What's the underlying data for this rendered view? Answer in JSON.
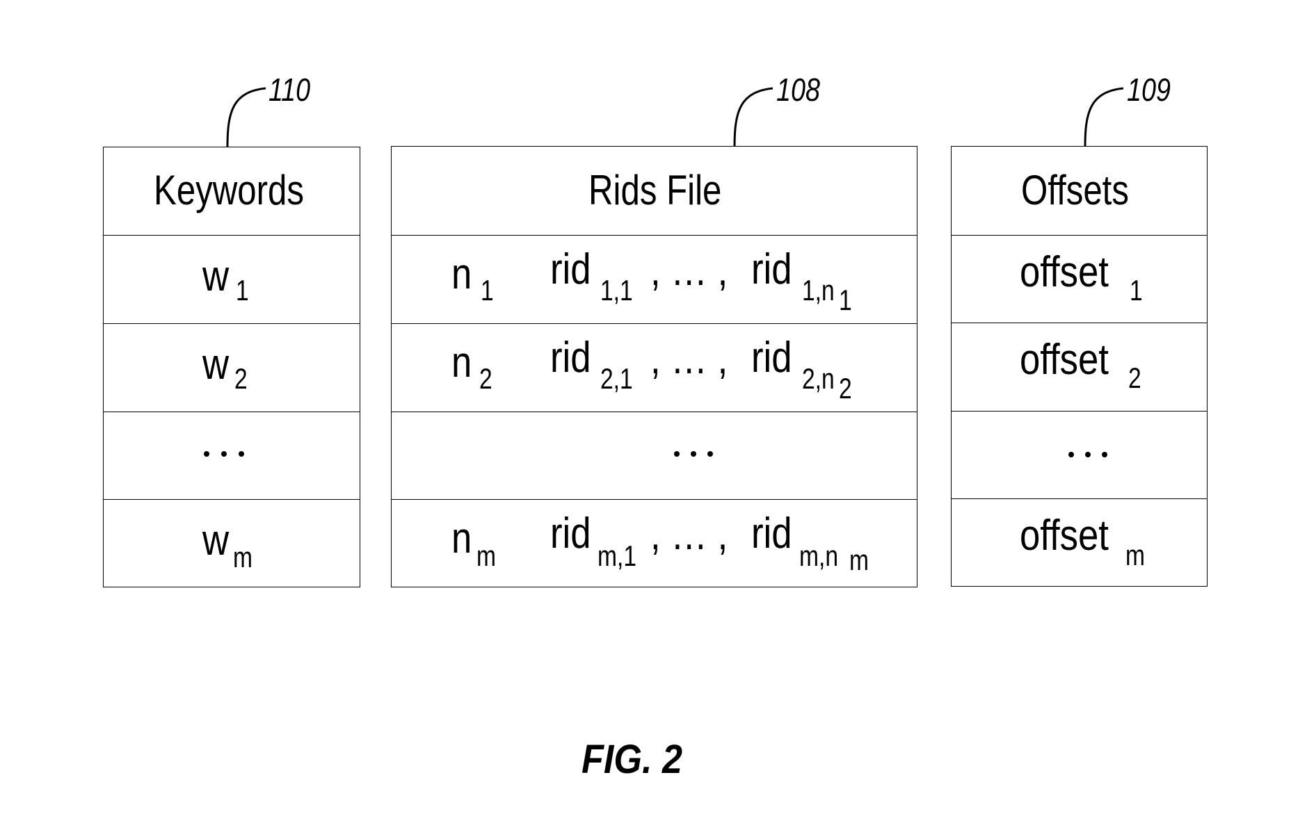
{
  "figure": {
    "caption": "FIG. 2",
    "references": [
      {
        "id": "110",
        "target": "keywords-table"
      },
      {
        "id": "108",
        "target": "rids-file-table"
      },
      {
        "id": "109",
        "target": "offsets-table"
      }
    ]
  },
  "keywords": {
    "header": "Keywords",
    "rows": [
      {
        "base": "w",
        "sub": "1"
      },
      {
        "base": "w",
        "sub": "2"
      },
      {
        "ellipsis": true
      },
      {
        "base": "w",
        "sub": "m"
      }
    ]
  },
  "rids_file": {
    "header": "Rids File",
    "rows": [
      {
        "count": "n",
        "count_sub": "1",
        "first": "rid",
        "first_sub": "1,1",
        "sep": ", … ,",
        "last": "rid",
        "last_sub": "1,n",
        "last_subsub": "1"
      },
      {
        "count": "n",
        "count_sub": "2",
        "first": "rid",
        "first_sub": "2,1",
        "sep": ", … ,",
        "last": "rid",
        "last_sub": "2,n",
        "last_subsub": "2"
      },
      {
        "ellipsis": true
      },
      {
        "count": "n",
        "count_sub": "m",
        "first": "rid",
        "first_sub": "m,1",
        "sep": ", … ,",
        "last": "rid",
        "last_sub": "m,n",
        "last_subsub": "m"
      }
    ]
  },
  "offsets": {
    "header": "Offsets",
    "rows": [
      {
        "base": "offset",
        "sub": "1"
      },
      {
        "base": "offset",
        "sub": "2"
      },
      {
        "ellipsis": true
      },
      {
        "base": "offset",
        "sub": "m"
      }
    ]
  }
}
